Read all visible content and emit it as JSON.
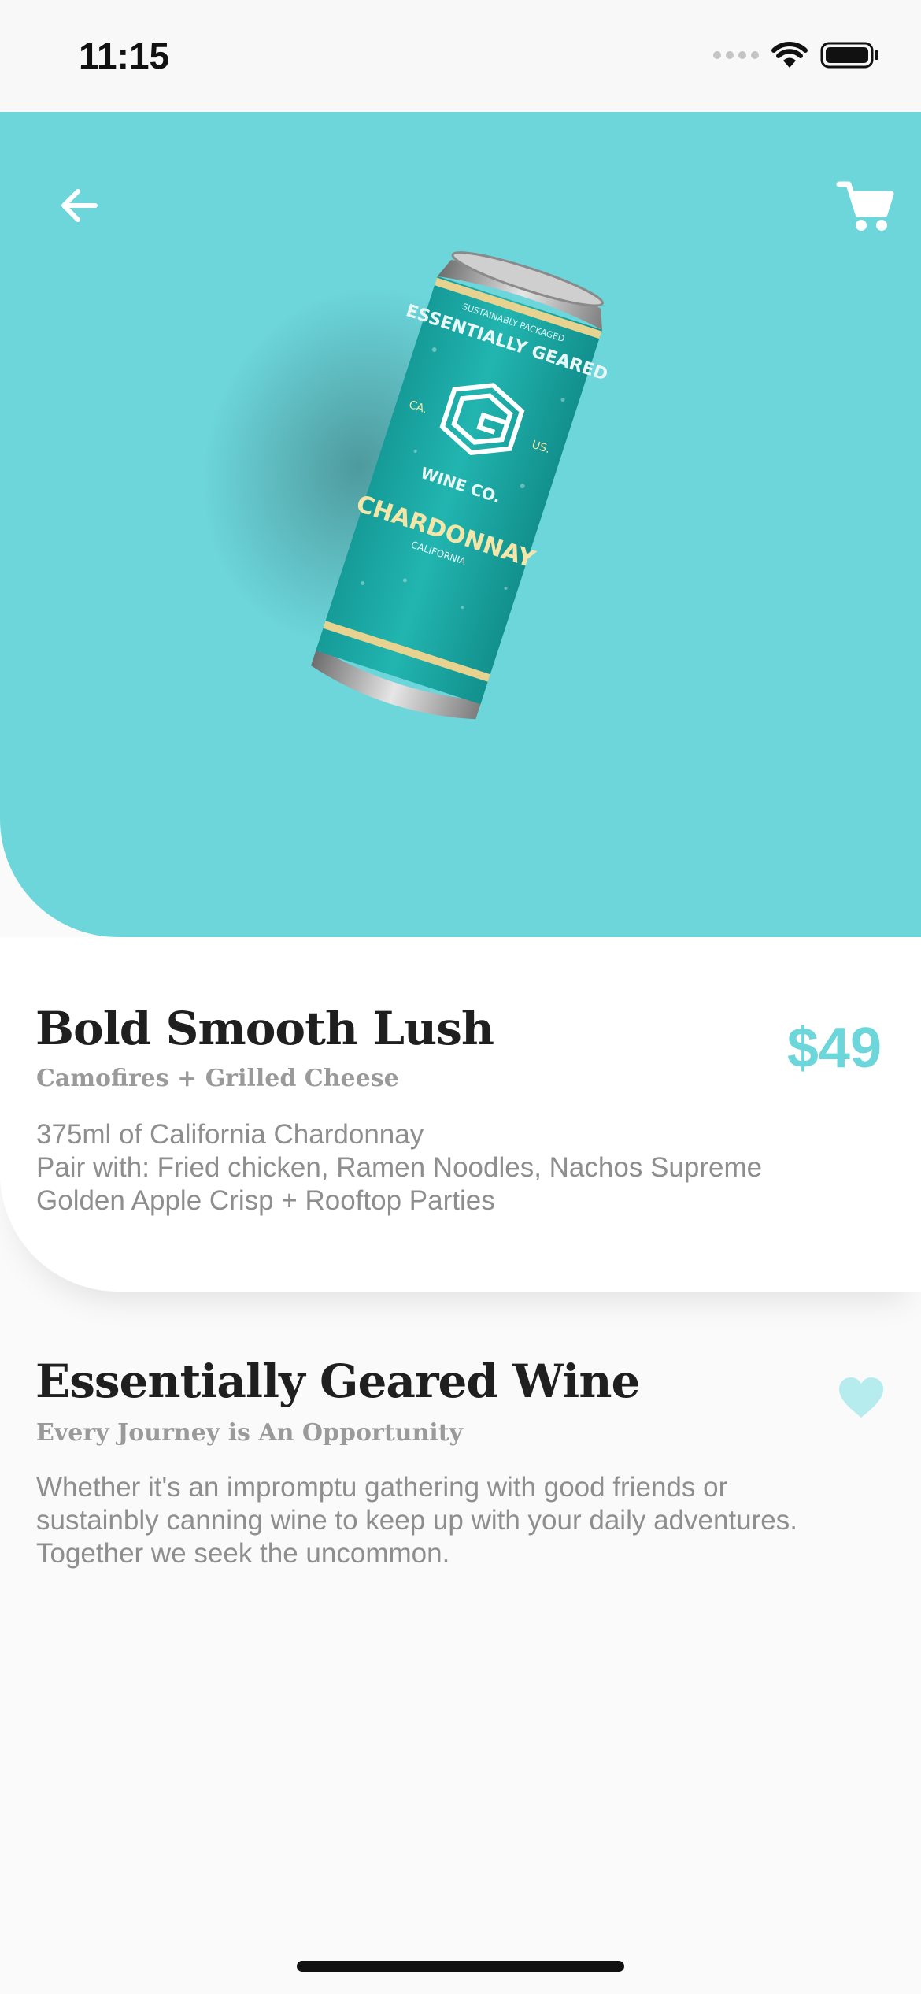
{
  "status_bar": {
    "time": "11:15"
  },
  "colors": {
    "accent": "#6cd6db",
    "favorite": "#b7ecee",
    "title_text": "#1f1f1f",
    "muted_text": "#8e8e8e"
  },
  "hero": {
    "back_icon": "arrow-left-icon",
    "cart_icon": "shopping-cart-icon",
    "product_image": {
      "can_top_text": "SUSTAINABLY PACKAGED",
      "can_brand_text": "ESSENTIALLY GEARED",
      "can_left_text": "CA.",
      "can_right_text": "US.",
      "can_company_text": "WINE CO.",
      "can_varietal_text": "CHARDONNAY",
      "can_region_text": "CALIFORNIA"
    }
  },
  "product": {
    "name": "Bold Smooth Lush",
    "subtitle": "Camofires + Grilled Cheese",
    "price": "$49",
    "description_lines": [
      "375ml of California Chardonnay",
      "Pair with: Fried chicken, Ramen Noodles, Nachos Supreme",
      "Golden Apple Crisp + Rooftop Parties"
    ]
  },
  "brand": {
    "name": "Essentially Geared Wine",
    "tagline": "Every Journey is An Opportunity",
    "favorite_icon": "heart-icon",
    "description_lines": [
      "Whether it's an impromptu gathering with good friends or",
      "sustainbly canning wine to keep up with your daily adventures.",
      "Together we seek the uncommon."
    ]
  }
}
